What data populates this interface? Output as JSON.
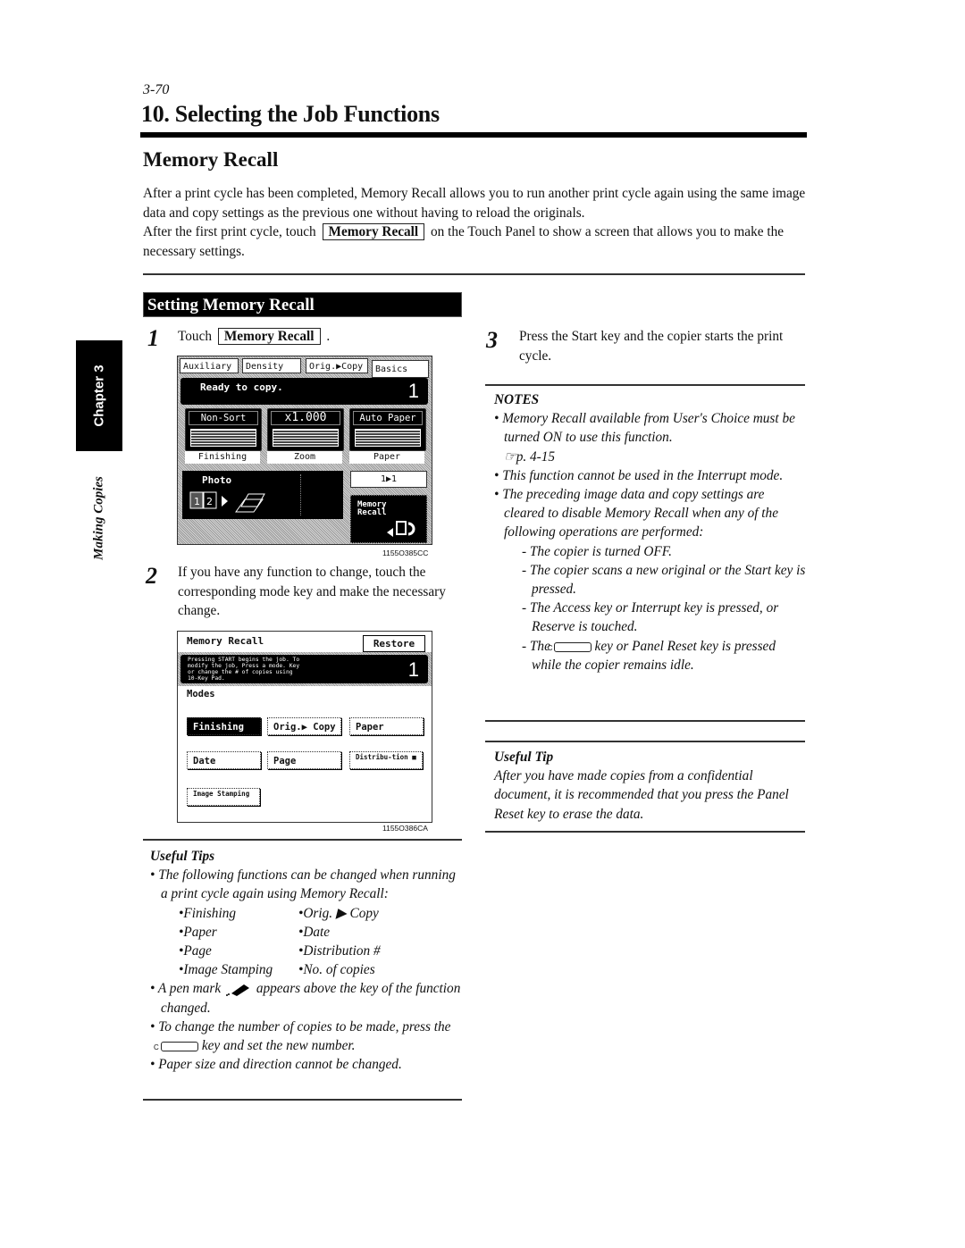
{
  "header": {
    "page_number": "3-70",
    "chapter_title": "10. Selecting the Job Functions",
    "section_title": "Memory Recall"
  },
  "intro": {
    "line1": "After a print cycle has been completed, Memory Recall allows you to run another print cycle again using the same image data and copy settings as the previous one without having to reload the originals.",
    "line2_pre": "After the first print cycle, touch",
    "line2_key": "Memory Recall",
    "line2_post": "on the Touch Panel to show a screen that allows you to make the necessary settings."
  },
  "side_tab": {
    "chapter": "Chapter 3",
    "section": "Making Copies"
  },
  "subsection": {
    "title": "Setting Memory Recall"
  },
  "steps": [
    {
      "number": "1",
      "pre": "Touch",
      "key": "Memory Recall",
      "post": "."
    },
    {
      "number": "2",
      "text": "If you have any function to change, touch the corresponding mode key and make the necessary change."
    },
    {
      "number": "3",
      "text": "Press the Start key and the copier starts the print cycle."
    }
  ],
  "panel1": {
    "tabs": [
      "Auxiliary",
      "Density",
      "Orig.▶Copy",
      "Basics"
    ],
    "status": "Ready to copy.",
    "copies": "1",
    "cells": [
      {
        "value": "Non-Sort",
        "caption": "Finishing"
      },
      {
        "value": "x1.000",
        "caption": "Zoom"
      },
      {
        "value": "Auto Paper",
        "caption": "Paper"
      }
    ],
    "mode_label": "Photo",
    "duplex": "1▶1",
    "memory_recall_key": "Memory Recall",
    "figure_id": "1155O385CC"
  },
  "panel2": {
    "title": "Memory Recall",
    "restore": "Restore",
    "message": "Pressing START begins the job. To modify the job, Press a mode. Key or change the # of copies using 10-Key Pad.",
    "copies": "1",
    "modes_label": "Modes",
    "keys": [
      "Finishing",
      "Orig.▶ Copy",
      "Paper",
      "Date",
      "Page",
      "Distribu-tion ■",
      "Image Stamping"
    ],
    "figure_id": "1155O386CA"
  },
  "useful_tips": {
    "heading": "Useful Tips",
    "intro": "The following functions can be changed when running a print cycle again using Memory Recall:",
    "functions": [
      "•Finishing",
      "•Orig. ▶ Copy",
      "•Paper",
      "•Date",
      "•Page",
      "•Distribution #",
      "•Image Stamping",
      "•No. of copies"
    ],
    "pen_pre": "A pen mark",
    "pen_post": "appears above the key of the function changed.",
    "copies_pre": "To change the number of copies to be made, press the",
    "copies_key": "C",
    "copies_post": "key and set the new number.",
    "paper": "Paper size and direction cannot be changed."
  },
  "notes": {
    "heading": "NOTES",
    "item1": "Memory Recall available from User's Choice must be turned ON to use this function.",
    "item1_ref": "☞p. 4-15",
    "item2": "This function cannot be used in the Interrupt mode.",
    "item3": "The preceding image data and copy settings are cleared to disable Memory Recall when any of the following operations are performed:",
    "sub1": "- The copier is turned OFF.",
    "sub2": "- The copier scans a new original or the Start key is pressed.",
    "sub3": "- The Access key or Interrupt key is pressed, or Reserve is touched.",
    "sub4_pre": "- The",
    "sub4_key": "C",
    "sub4_post": "key or Panel Reset key is pressed while the copier remains idle."
  },
  "useful_tip": {
    "heading": "Useful Tip",
    "text": "After you have made copies from a confidential document, it is recommended that you press the Panel Reset key to erase the data."
  }
}
